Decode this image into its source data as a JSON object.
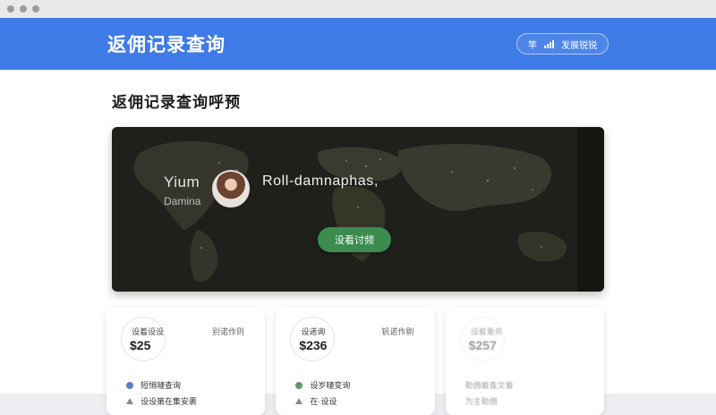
{
  "window": {
    "controls": [
      "close",
      "minimize",
      "maximize"
    ]
  },
  "header": {
    "title": "返佣记录查询",
    "button_prefix": "竿",
    "button_label": "发展锐锐",
    "signal_icon": "signal-bars-icon"
  },
  "main": {
    "page_title": "返佣记录查询呼预"
  },
  "hero": {
    "left_big": "Yium",
    "left_small": "Damina",
    "name": "Roll-damnaphas,",
    "button_label": "没看讨频",
    "avatar_icon": "user-avatar"
  },
  "cards": [
    {
      "label": "设着设设",
      "value": "$25",
      "right": "别诺作则",
      "item1": "短悄嗹查询",
      "item1_color": "#5b7fbf",
      "item2": "设设第在集安裹"
    },
    {
      "label": "设递询",
      "value": "$236",
      "right": "钒诺作剔",
      "item1": "设岁嗹变询",
      "item1_color": "#5e9a6a",
      "item2": "在·设设"
    },
    {
      "label": "设着重务",
      "value": "$257",
      "right": "",
      "item1": "勒佣着查文着",
      "item1_color": "",
      "item2": "为主勒佣"
    }
  ],
  "colors": {
    "header": "#3f7be6",
    "hero_button": "#3b8c4e"
  }
}
